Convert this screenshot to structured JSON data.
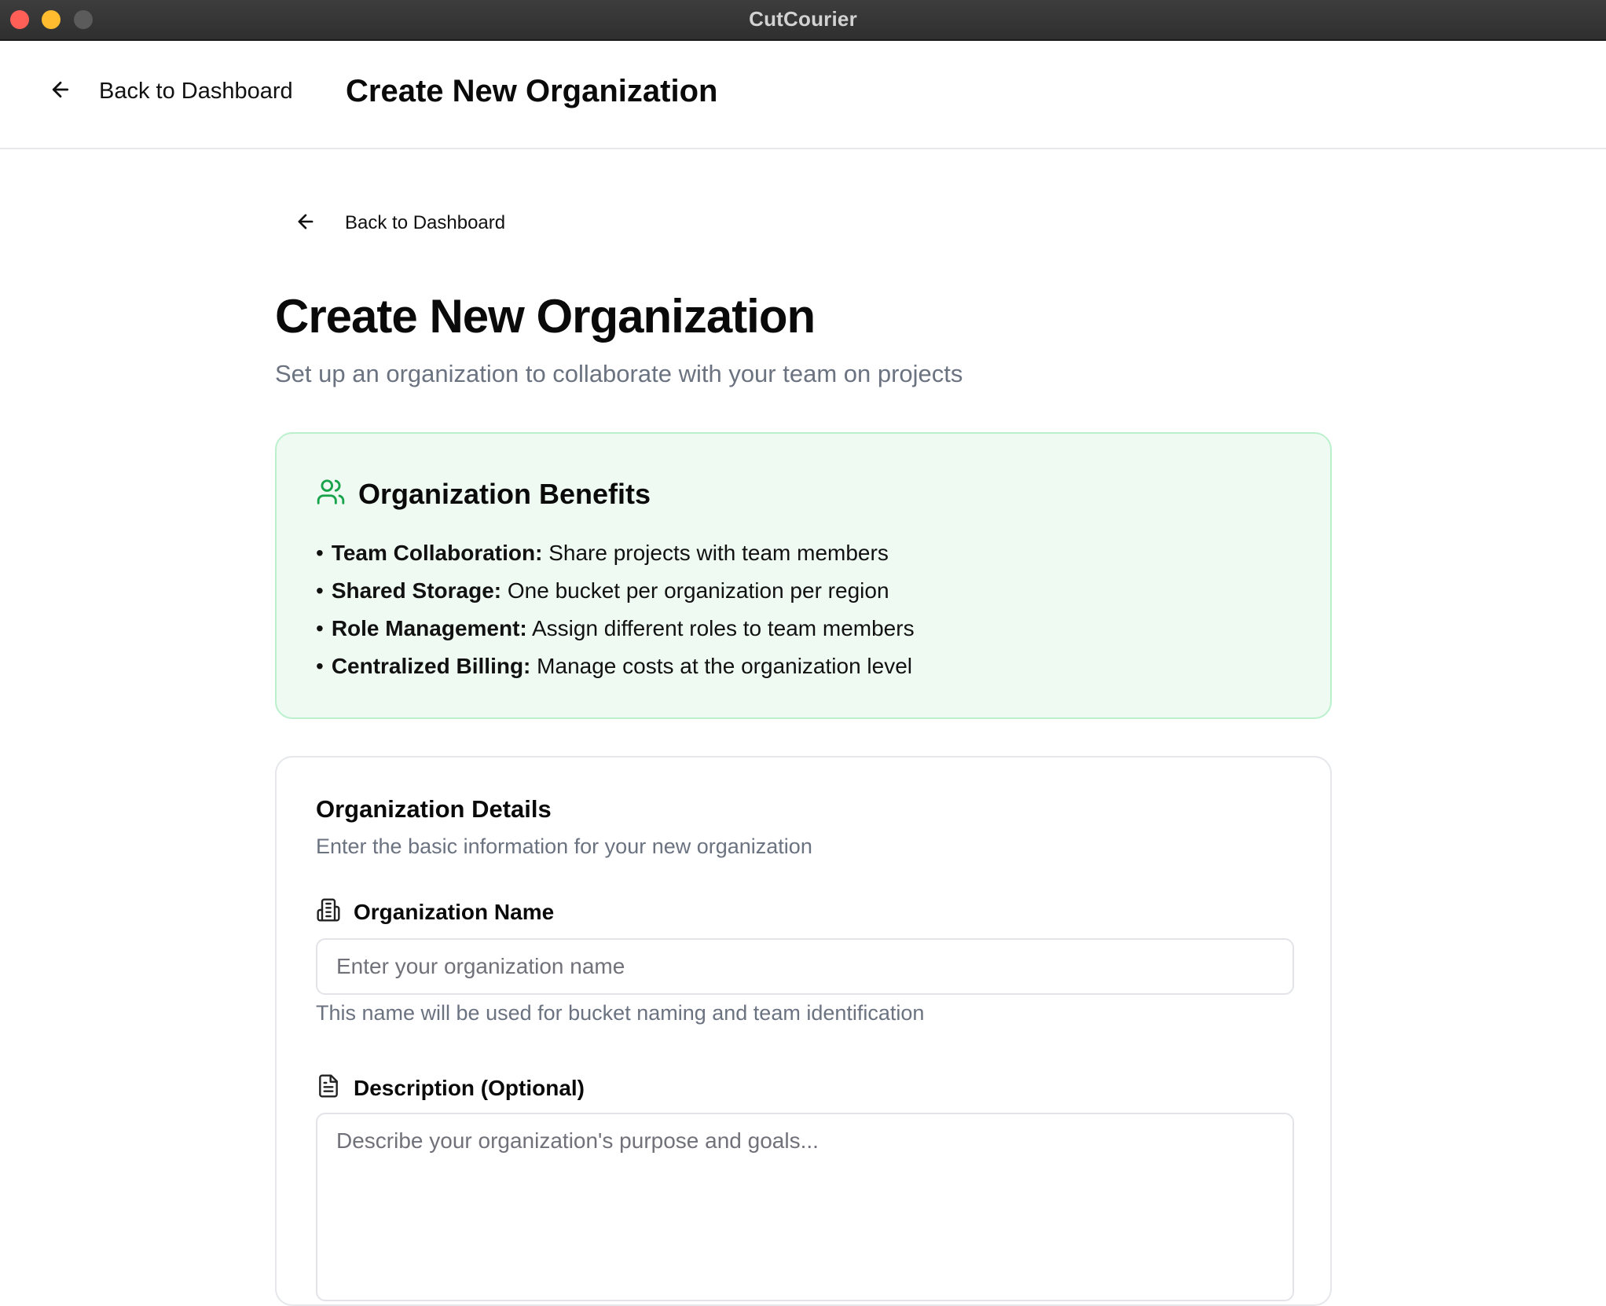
{
  "window": {
    "title": "CutCourier"
  },
  "header": {
    "back_label": "Back to Dashboard",
    "title": "Create New Organization"
  },
  "page": {
    "back_label": "Back to Dashboard",
    "title": "Create New Organization",
    "subtitle": "Set up an organization to collaborate with your team on projects"
  },
  "benefits": {
    "icon": "users-icon",
    "title": "Organization Benefits",
    "items": [
      {
        "term": "Team Collaboration:",
        "text": " Share projects with team members"
      },
      {
        "term": "Shared Storage:",
        "text": " One bucket per organization per region"
      },
      {
        "term": "Role Management:",
        "text": " Assign different roles to team members"
      },
      {
        "term": "Centralized Billing:",
        "text": " Manage costs at the organization level"
      }
    ]
  },
  "details": {
    "title": "Organization Details",
    "subtitle": "Enter the basic information for your new organization",
    "name_field": {
      "icon": "building-icon",
      "label": "Organization Name",
      "placeholder": "Enter your organization name",
      "value": "",
      "helper": "This name will be used for bucket naming and team identification"
    },
    "description_field": {
      "icon": "document-icon",
      "label": "Description (Optional)",
      "placeholder": "Describe your organization's purpose and goals...",
      "value": ""
    }
  },
  "colors": {
    "benefits_bg": "#effaf3",
    "benefits_border": "#bbf0cd",
    "benefits_icon": "#16a34a",
    "muted_text": "#6b7280"
  }
}
